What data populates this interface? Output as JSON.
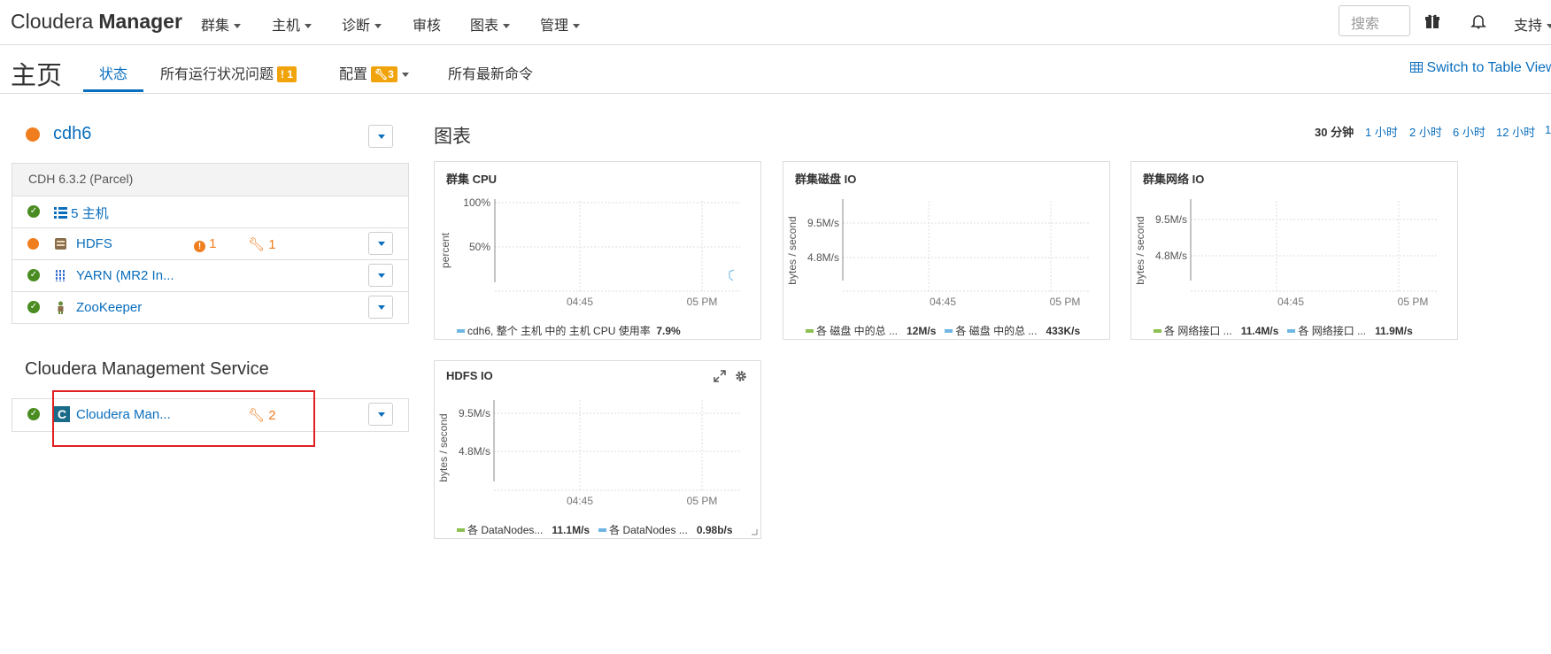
{
  "topnav": {
    "brand_light": "Cloudera",
    "brand_bold": "Manager",
    "items": [
      {
        "label": "群集",
        "dropdown": true
      },
      {
        "label": "主机",
        "dropdown": true
      },
      {
        "label": "诊断",
        "dropdown": true
      },
      {
        "label": "审核",
        "dropdown": false
      },
      {
        "label": "图表",
        "dropdown": true
      },
      {
        "label": "管理",
        "dropdown": true
      }
    ],
    "search_placeholder": "搜索",
    "support_label": "支持"
  },
  "subnav": {
    "page_title": "主页",
    "tabs": [
      {
        "label": "状态",
        "active": true
      },
      {
        "label": "所有运行状况问题",
        "badge": "1",
        "badge_icon": "alert-icon"
      },
      {
        "label": "配置",
        "badge": "3",
        "badge_icon": "wrench-icon",
        "dropdown": true
      },
      {
        "label": "所有最新命令"
      }
    ],
    "switch_table_view": "Switch to Table View"
  },
  "cluster": {
    "name": "cdh6",
    "version": "CDH 6.3.2 (Parcel)",
    "hosts_label": "5 主机",
    "services": [
      {
        "name": "HDFS",
        "status": "warning",
        "icon": "hdfs-icon",
        "health_issues": "1",
        "config_issues": "1"
      },
      {
        "name": "YARN (MR2 In...",
        "status": "good",
        "icon": "yarn-icon"
      },
      {
        "name": "ZooKeeper",
        "status": "good",
        "icon": "zookeeper-icon"
      }
    ]
  },
  "management": {
    "title": "Cloudera Management Service",
    "service_name": "Cloudera Man...",
    "config_issues": "2"
  },
  "charts_section": {
    "title": "图表",
    "time_ranges": [
      {
        "label": "30 分钟",
        "active": true
      },
      {
        "label": "1 小时"
      },
      {
        "label": "2 小时"
      },
      {
        "label": "6 小时"
      },
      {
        "label": "12 小时"
      },
      {
        "label": "1"
      }
    ]
  },
  "colors": {
    "accent": "#0a6ebd",
    "warning": "#f07d1e",
    "good": "#4a8c21",
    "badge": "#f0a30a",
    "highlight_box": "#e02020",
    "series_blue": "#6fb6e6",
    "series_green": "#8cc152"
  },
  "chart_data": [
    {
      "type": "line",
      "title": "群集 CPU",
      "ylabel": "percent",
      "y_ticks": [
        "100%",
        "50%"
      ],
      "x_ticks": [
        "04:45",
        "05 PM"
      ],
      "series": [
        {
          "name": "cdh6, 整个 主机 中的 主机 CPU 使用率",
          "value_label": "7.9%"
        }
      ]
    },
    {
      "type": "line",
      "title": "群集磁盘 IO",
      "ylabel": "bytes / second",
      "y_ticks": [
        "9.5M/s",
        "4.8M/s"
      ],
      "x_ticks": [
        "04:45",
        "05 PM"
      ],
      "series": [
        {
          "name": "各 磁盘 中的总 ...",
          "value_label": "12M/s"
        },
        {
          "name": "各 磁盘 中的总 ...",
          "value_label": "433K/s"
        }
      ]
    },
    {
      "type": "line",
      "title": "群集网络 IO",
      "ylabel": "bytes / second",
      "y_ticks": [
        "9.5M/s",
        "4.8M/s"
      ],
      "x_ticks": [
        "04:45",
        "05 PM"
      ],
      "series": [
        {
          "name": "各 网络接口 ...",
          "value_label": "11.4M/s"
        },
        {
          "name": "各 网络接口 ...",
          "value_label": "11.9M/s"
        }
      ]
    },
    {
      "type": "line",
      "title": "HDFS IO",
      "ylabel": "bytes / second",
      "y_ticks": [
        "9.5M/s",
        "4.8M/s"
      ],
      "x_ticks": [
        "04:45",
        "05 PM"
      ],
      "series": [
        {
          "name": "各 DataNodes...",
          "value_label": "11.1M/s"
        },
        {
          "name": "各 DataNodes ...",
          "value_label": "0.98b/s"
        }
      ]
    }
  ]
}
